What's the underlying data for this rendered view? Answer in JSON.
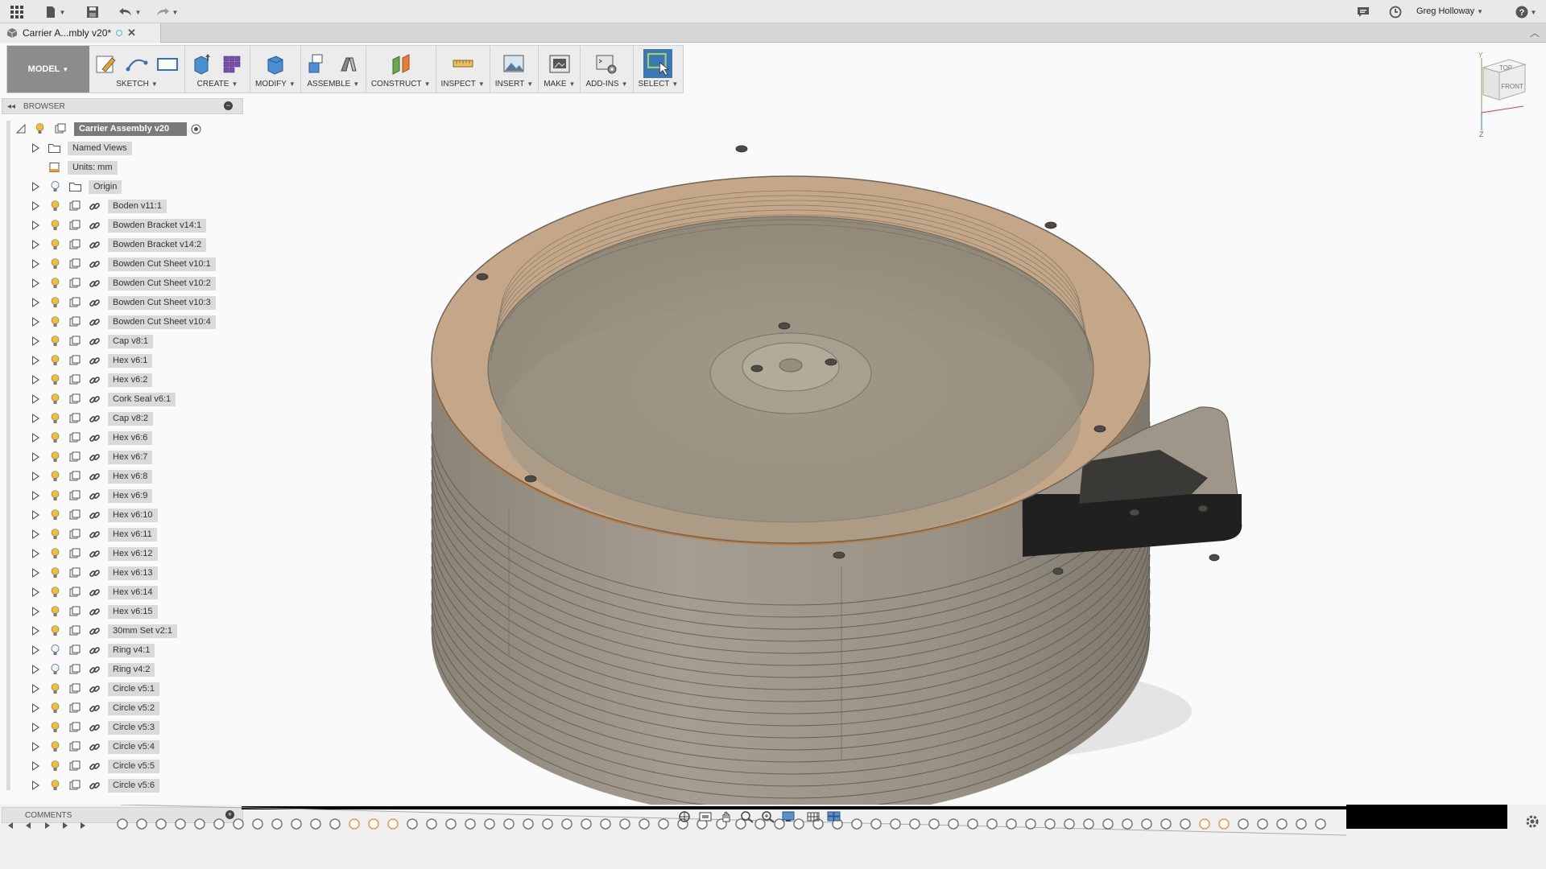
{
  "app": {
    "user_name": "Greg Holloway",
    "help_label": "?"
  },
  "document": {
    "tab_title": "Carrier A...mbly v20*"
  },
  "toolbar": {
    "workspace": "MODEL",
    "groups": [
      {
        "id": "sketch",
        "label": "SKETCH"
      },
      {
        "id": "create",
        "label": "CREATE"
      },
      {
        "id": "modify",
        "label": "MODIFY"
      },
      {
        "id": "assemble",
        "label": "ASSEMBLE"
      },
      {
        "id": "construct",
        "label": "CONSTRUCT"
      },
      {
        "id": "inspect",
        "label": "INSPECT"
      },
      {
        "id": "insert",
        "label": "INSERT"
      },
      {
        "id": "make",
        "label": "MAKE"
      },
      {
        "id": "addins",
        "label": "ADD-INS"
      },
      {
        "id": "select",
        "label": "SELECT"
      }
    ]
  },
  "browser": {
    "header": "BROWSER",
    "root": "Carrier Assembly v20",
    "folders": [
      {
        "label": "Named Views"
      },
      {
        "label": "Units: mm"
      },
      {
        "label": "Origin"
      }
    ],
    "components": [
      "Boden v11:1",
      "Bowden Bracket v14:1",
      "Bowden Bracket v14:2",
      "Bowden Cut Sheet v10:1",
      "Bowden Cut Sheet v10:2",
      "Bowden Cut Sheet v10:3",
      "Bowden Cut Sheet v10:4",
      "Cap v8:1",
      "Hex v6:1",
      "Hex v6:2",
      "Cork Seal v6:1",
      "Cap v8:2",
      "Hex v6:6",
      "Hex v6:7",
      "Hex v6:8",
      "Hex v6:9",
      "Hex v6:10",
      "Hex v6:11",
      "Hex v6:12",
      "Hex v6:13",
      "Hex v6:14",
      "Hex v6:15",
      "30mm Set v2:1",
      "Ring v4:1",
      "Ring v4:2",
      "Circle v5:1",
      "Circle v5:2",
      "Circle v5:3",
      "Circle v5:4",
      "Circle v5:5",
      "Circle v5:6"
    ]
  },
  "viewcube": {
    "top": "TOP",
    "front": "FRONT",
    "z": "Z",
    "y": "Y"
  },
  "comments": {
    "label": "COMMENTS"
  },
  "colors": {
    "model_top": "#c4a788",
    "model_wall": "#8f8a7e",
    "active_select": "#3b78b5"
  }
}
